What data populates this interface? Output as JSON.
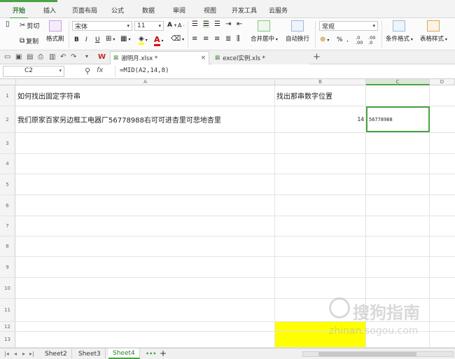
{
  "tabs": [
    "开始",
    "插入",
    "页面布局",
    "公式",
    "数据",
    "审阅",
    "视图",
    "开发工具",
    "云服务"
  ],
  "ribbon": {
    "cut": "剪切",
    "copy": "复制",
    "format_painter": "格式刷",
    "font_name": "宋体",
    "font_size": "11",
    "bold": "B",
    "italic": "I",
    "underline": "U",
    "merge_center": "合并居中",
    "wrap_text": "自动换行",
    "number_format": "常规",
    "percent": "%",
    "thousands": ",",
    "decimal_plus": ".0 .00",
    "decimal_minus": ".00 .0",
    "conditional_format": "条件格式",
    "table_style": "表格样式",
    "font_grow": "A",
    "font_shrink": "A",
    "font_color_letter": "A"
  },
  "doc_tabs": [
    {
      "label": "谢明月.xlsx *",
      "close": "×"
    },
    {
      "label": "excel实例.xls *",
      "close": ""
    }
  ],
  "new_tab": "+",
  "formula_bar": {
    "cell_ref": "C2",
    "fx_label": "fx",
    "formula": "=MID(A2,14,8)"
  },
  "columns": [
    "A",
    "B",
    "C",
    "D"
  ],
  "rows": [
    {
      "num": "1",
      "a": "如何找出固定字符串",
      "b": "找出那串数字位置",
      "c": ""
    },
    {
      "num": "2",
      "a": "我们原家百家另边框工电器厂56778988右可可进杏里可悲地杏里",
      "b": "14",
      "c": "56778988"
    },
    {
      "num": "3",
      "a": "",
      "b": "",
      "c": ""
    },
    {
      "num": "4",
      "a": "",
      "b": "",
      "c": ""
    },
    {
      "num": "5",
      "a": "",
      "b": "",
      "c": ""
    },
    {
      "num": "6",
      "a": "",
      "b": "",
      "c": ""
    },
    {
      "num": "7",
      "a": "",
      "b": "",
      "c": ""
    },
    {
      "num": "8",
      "a": "",
      "b": "",
      "c": ""
    },
    {
      "num": "9",
      "a": "",
      "b": "",
      "c": ""
    },
    {
      "num": "10",
      "a": "",
      "b": "",
      "c": ""
    },
    {
      "num": "11",
      "a": "",
      "b": "",
      "c": ""
    },
    {
      "num": "12",
      "a": "",
      "b": "",
      "c": ""
    },
    {
      "num": "13",
      "a": "",
      "b": "",
      "c": ""
    }
  ],
  "yellow_cells": [
    "B12",
    "B13"
  ],
  "sheets": [
    "Sheet2",
    "Sheet3",
    "Sheet4"
  ],
  "active_sheet": "Sheet4",
  "add_sheet": "+",
  "watermark": {
    "cn": "搜狗指南",
    "en": "zhinan.sogou.com"
  },
  "colors": {
    "accent": "#4aa344",
    "yellow": "#ffff00",
    "selected_header": "#dbe8d8"
  }
}
